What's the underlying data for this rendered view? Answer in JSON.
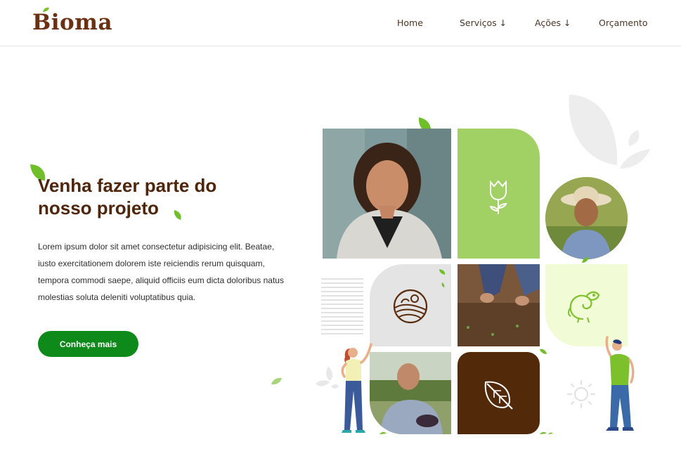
{
  "brand": {
    "name": "Bioma"
  },
  "nav": {
    "items": [
      "Home",
      "Serviços ↓",
      "Ações ↓",
      "Orçamento"
    ]
  },
  "hero": {
    "title_line1": "Venha fazer parte do",
    "title_line2": "nosso projeto",
    "body": "Lorem ipsum dolor sit amet consectetur adipisicing elit. Beatae, iusto exercitationem dolorem iste reiciendis rerum quisquam, tempora commodi saepe, aliquid officiis eum dicta doloribus natus molestias soluta deleniti voluptatibus quia.",
    "cta_label": "Conheça mais"
  },
  "colors": {
    "brand_brown": "#4f250b",
    "accent_green": "#0d8a1a",
    "tile_light_green": "#a1d064",
    "tile_pale_green": "#f1fbd6",
    "tile_gray": "#e4e4e4",
    "tile_dark_brown": "#522a0a"
  },
  "icons": [
    "tulip-icon",
    "farmland-globe-icon",
    "chameleon-icon",
    "leaf-icon",
    "sun-icon"
  ]
}
